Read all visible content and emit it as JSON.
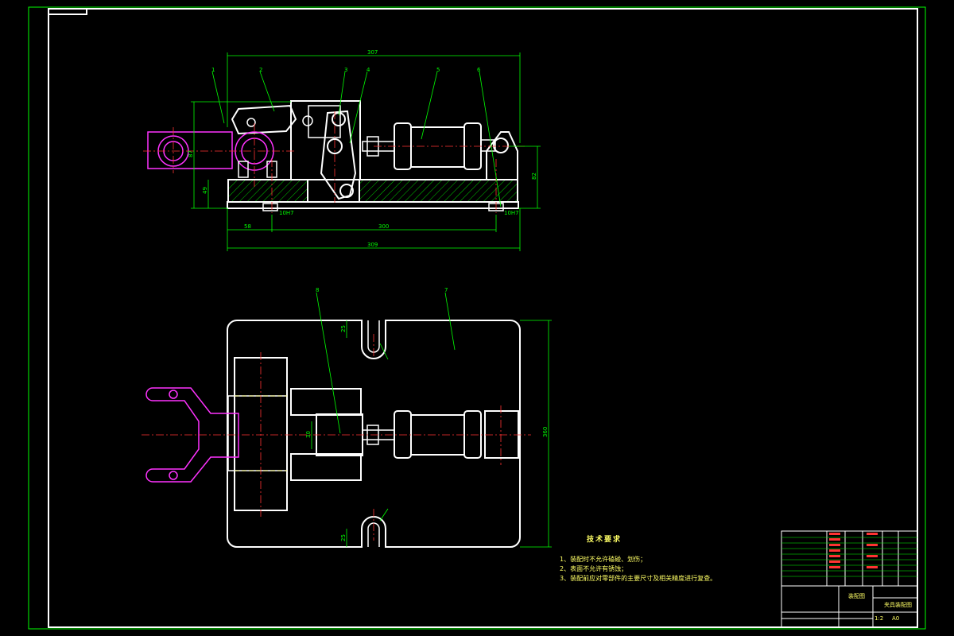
{
  "drawing": {
    "dimensions": {
      "top_total": "307",
      "height_87": "87",
      "height_82": "82",
      "height_49": "49",
      "left_58": "58",
      "span_300": "300",
      "bottom_309": "309",
      "slot_25_top": "25",
      "slot_25_bottom": "25",
      "plan_height_360": "360",
      "plan_30": "30",
      "fit_left": "10H7",
      "fit_right": "10H7"
    },
    "balloons": [
      "1",
      "2",
      "3",
      "4",
      "5",
      "6",
      "7",
      "8"
    ],
    "technical_requirements": {
      "title": "技术要求",
      "items": [
        "1、装配时不允许磕碰、划伤；",
        "2、表面不允许有锈蚀；",
        "3、装配前应对零部件的主要尺寸及相关精度进行复查。"
      ]
    },
    "title_block": {
      "drawing_name": "夹具装配图",
      "view_label": "装配图",
      "scale_label": "1:2",
      "sheet": "A0"
    }
  }
}
